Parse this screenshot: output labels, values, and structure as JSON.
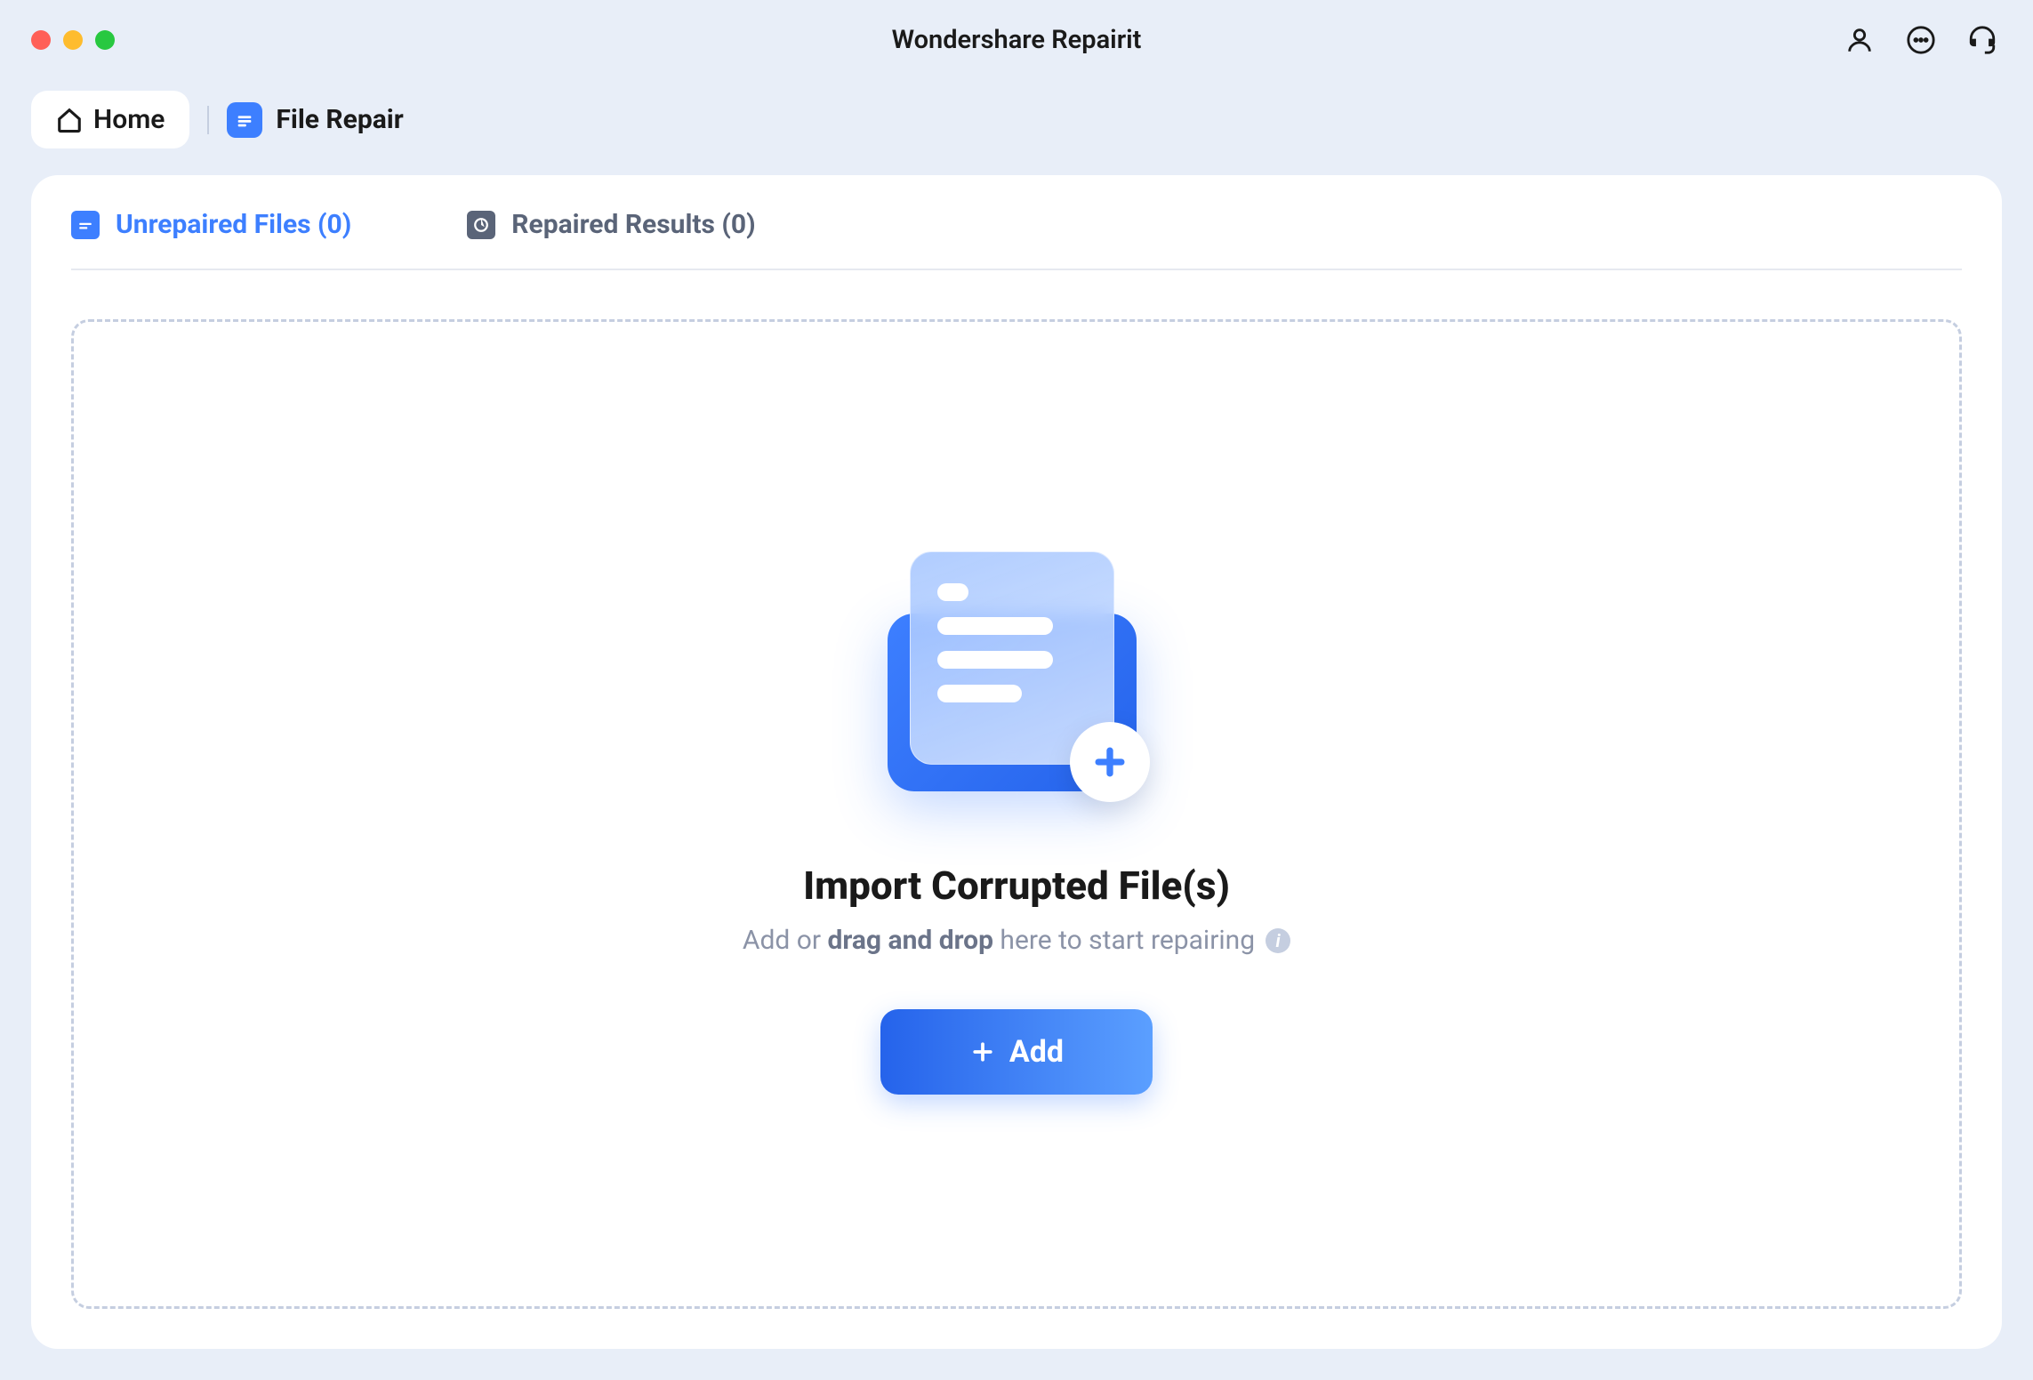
{
  "app": {
    "title": "Wondershare Repairit"
  },
  "breadcrumb": {
    "home_label": "Home",
    "section_label": "File Repair"
  },
  "tabs": {
    "unrepaired": {
      "label": "Unrepaired Files (0)"
    },
    "repaired": {
      "label": "Repaired Results (0)"
    }
  },
  "dropzone": {
    "title": "Import Corrupted File(s)",
    "subtitle_prefix": "Add or ",
    "subtitle_bold": "drag and drop",
    "subtitle_suffix": " here to start repairing",
    "add_button": "Add"
  }
}
